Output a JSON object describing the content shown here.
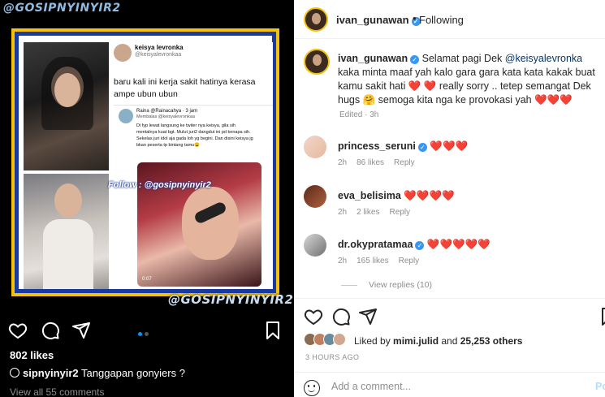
{
  "left": {
    "watermark_top": "@GOSIPNYINYIR2",
    "watermark_bottom": "@GOSIPNYINYIR2",
    "follow_watermark": "Follow : @gosipnyinyir2",
    "tweet": {
      "name": "keisya levronka",
      "handle": "@keisyalevronkaa",
      "text": "baru kali ini kerja sakit hatinya kerasa ampe ubun ubun",
      "reply": {
        "name": "Raina @Rainacahya · 3 jam",
        "sub": "Membalas @keisyalevronkaa",
        "text": "Di fyp lewat langsung ke twiter nya keisya, gila sih mentalnya kuat bgt. Mulut juri2 dangdut ini pd kenapa sih. Sekelas juri idol aja gada loh yg begini. Dan disini keisya jg bkan peserta tp bintang tamu😩",
        "video_time": "0:07"
      }
    },
    "likes": "802 likes",
    "caption_user": "sipnyinyir2",
    "caption_text": "Tanggapan gonyiers ?",
    "comments_link": "View all 55 comments"
  },
  "header": {
    "username": "ivan_gunawan",
    "dot": "•",
    "follow_status": "Following"
  },
  "caption": {
    "username": "ivan_gunawan",
    "text_before": "Selamat pagi Dek ",
    "mention": "@keisyalevronka",
    "text_mid": " kaka minta maaf yah kalo gara gara kata kata kakak buat kamu sakit hati ",
    "text_hearts1": "❤️ ❤️",
    "text_after": " really sorry .. tetep semangat Dek hugs 🤗 semoga kita nga ke provokasi yah ",
    "text_hearts2": "❤️❤️❤️",
    "meta": "Edited · 3h"
  },
  "comments": [
    {
      "username": "princess_seruni",
      "verified": true,
      "text": "❤️❤️❤️",
      "time": "2h",
      "likes": "86 likes",
      "reply": "Reply"
    },
    {
      "username": "eva_belisima",
      "verified": false,
      "text": "❤️❤️❤️❤️",
      "time": "2h",
      "likes": "2 likes",
      "reply": "Reply"
    },
    {
      "username": "dr.okypratamaa",
      "verified": true,
      "text": "❤️❤️❤️❤️❤️",
      "time": "2h",
      "likes": "165 likes",
      "reply": "Reply"
    }
  ],
  "view_replies": "View replies (10)",
  "liked_by": {
    "prefix": "Liked by ",
    "user": "mimi.julid",
    "mid": " and ",
    "count": "25,253 others"
  },
  "time_ago": "3 HOURS AGO",
  "add_comment": {
    "placeholder": "Add a comment...",
    "post_label": "Post"
  },
  "colors": {
    "accent": "#0095f6",
    "heart": "#ed4956",
    "verified": "#3897f0",
    "frame_gold": "#f4c20d",
    "frame_blue": "#1a3aa0"
  }
}
